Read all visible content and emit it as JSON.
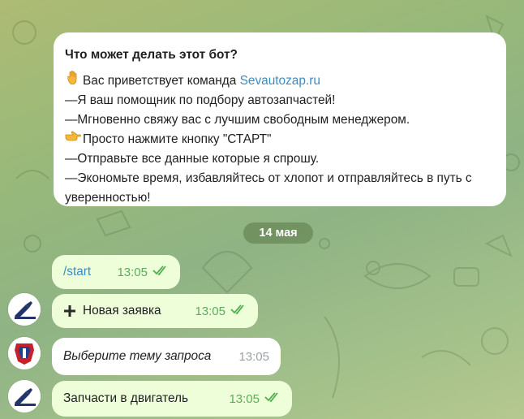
{
  "info": {
    "title": "Что может делать этот бот?",
    "greeting_prefix": "Вас приветствует команда ",
    "greeting_link": "Sevautozap.ru",
    "line2": "—Я ваш помощник по подбору автозапчастей!",
    "line3": "—Мгновенно свяжу вас с лучшим свободным менеджером.",
    "line4": "Просто нажмите кнопку \"СТАРТ\"",
    "line5": "—Отправьте все данные которые я спрошу.",
    "line6": "—Экономьте время, избавляйтесь от хлопот и отправляйтесь в путь с уверенностью!",
    "hand_icon": "raised-hand-icon",
    "pointing_icon": "pointing-right-icon"
  },
  "date_divider": "14 мая",
  "messages": [
    {
      "text": "/start",
      "time": "13:05"
    },
    {
      "text": "Новая заявка",
      "time": "13:05",
      "icon": "plus-icon"
    },
    {
      "text": "Выберите тему запроса",
      "time": "13:05"
    },
    {
      "text": "Запчасти в двигатель",
      "time": "13:05"
    }
  ],
  "colors": {
    "bubble_out": "#eefed9",
    "bubble_in": "#ffffff",
    "link": "#3a8cc4",
    "read_ticks": "#4fae4e"
  }
}
